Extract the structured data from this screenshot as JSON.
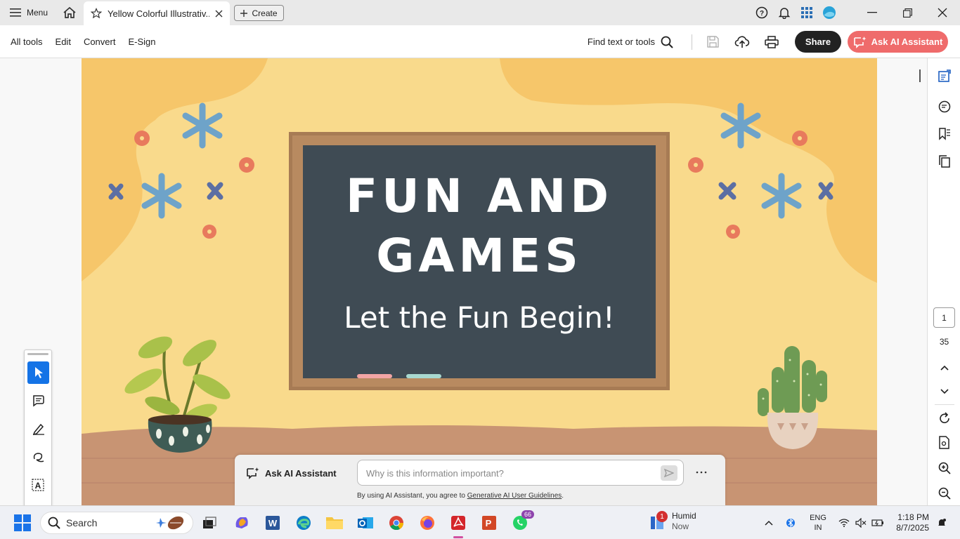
{
  "titlebar": {
    "menu_label": "Menu",
    "tab_title": "Yellow Colorful Illustrativ...",
    "create_label": "Create"
  },
  "toolbar": {
    "menu": [
      "All tools",
      "Edit",
      "Convert",
      "E-Sign"
    ],
    "find_label": "Find text or tools",
    "share_label": "Share",
    "ai_label": "Ask AI Assistant"
  },
  "slide": {
    "title_line1": "FUN AND",
    "title_line2": "GAMES",
    "subtitle": "Let the Fun Begin!"
  },
  "navigation": {
    "current_page": "1",
    "total_pages": "35"
  },
  "ai_assistant": {
    "label": "Ask AI Assistant",
    "placeholder": "Why is this information important?",
    "disclaimer_prefix": "By using AI Assistant, you agree to ",
    "disclaimer_link": "Generative AI User Guidelines",
    "disclaimer_suffix": "."
  },
  "taskbar": {
    "search_label": "Search",
    "whatsapp_badge": "66",
    "weather_badge": "1",
    "weather_title": "Humid",
    "weather_sub": "Now",
    "lang_line1": "ENG",
    "lang_line2": "IN",
    "time": "1:18 PM",
    "date": "8/7/2025"
  },
  "colors": {
    "accent_blue": "#1473e6",
    "ai_button": "#ef6b6b",
    "chalkboard": "#3f4b54",
    "frame": "#a77b54",
    "background_yellow": "#f9da8c"
  }
}
